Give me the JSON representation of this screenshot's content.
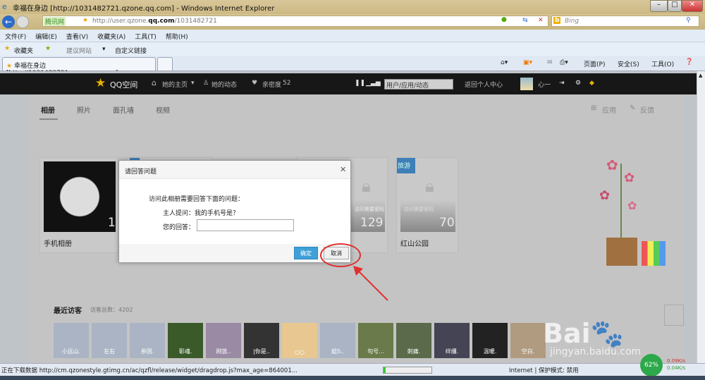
{
  "window": {
    "title": "幸福在身边 [http://1031482721.qzone.qq.com] - Windows Internet Explorer"
  },
  "address": {
    "badge": "腾讯网",
    "url_prefix": "http://user.qzone.",
    "url_domain": "qq.com",
    "url_suffix": "/1031482721",
    "search_placeholder": "Bing"
  },
  "menu": [
    "文件(F)",
    "编辑(E)",
    "查看(V)",
    "收藏夹(A)",
    "工具(T)",
    "帮助(H)"
  ],
  "favorites": {
    "label": "收藏夹",
    "items": [
      "建议网站",
      "自定义链接"
    ]
  },
  "tab": {
    "label": "幸福在身边 [http://1031482721.qzone.qq.com]"
  },
  "commandbar": [
    "页面(P)",
    "安全(S)",
    "工具(O)"
  ],
  "qq": {
    "logo": "QQ空间",
    "nav": [
      "她的主页",
      "她的动态"
    ],
    "intimacy_label": "亲密度",
    "intimacy": "52",
    "search_placeholder": "用户/应用/动态",
    "back": "返回个人中心",
    "username": "心一"
  },
  "album_tabs": [
    "相册",
    "照片",
    "面孔墙",
    "视频"
  ],
  "right_links": [
    "应用",
    "反馈"
  ],
  "albums": [
    {
      "name": "手机相册",
      "count": "1"
    },
    {
      "name": "",
      "count": "129",
      "lock_text": "访问需要密码"
    },
    {
      "name": "红山公园",
      "count": "70",
      "tag": "旅游",
      "lock_text": "访问需要密码"
    }
  ],
  "dialog": {
    "title": "请回答问题",
    "intro": "访问此相册需要回答下面的问题：",
    "question_label": "主人提问：",
    "question": "我的手机号是？",
    "answer_label": "您的回答：",
    "answer_value": "",
    "confirm": "确定",
    "cancel": "取消"
  },
  "visitors": {
    "title": "最近访客",
    "total_label": "访客总数：",
    "total": "4202",
    "items": [
      "小远山.",
      "左右",
      "参国.",
      "彰魂.",
      "刚篮..",
      "|你是..",
      "○○",
      "姐S..",
      "句号...",
      "刺痛.",
      "绊缰.",
      "温暖.",
      "空白."
    ]
  },
  "status": {
    "text": "正在下载数据 http://cm.qzonestyle.gtimg.cn/ac/qzfl/release/widget/dragdrop.js?max_age=864001...",
    "zone": "Internet | 保护模式: 禁用",
    "progress": 0.05,
    "net_percent": "62%",
    "up": "0.09K/s",
    "down": "0.04K/s"
  },
  "watermark": {
    "text": "Baidu经验 jingyan.baidu.com"
  },
  "colors": {
    "accent": "#3fa0d8",
    "annotation": "#e03030",
    "header": "#171717"
  }
}
